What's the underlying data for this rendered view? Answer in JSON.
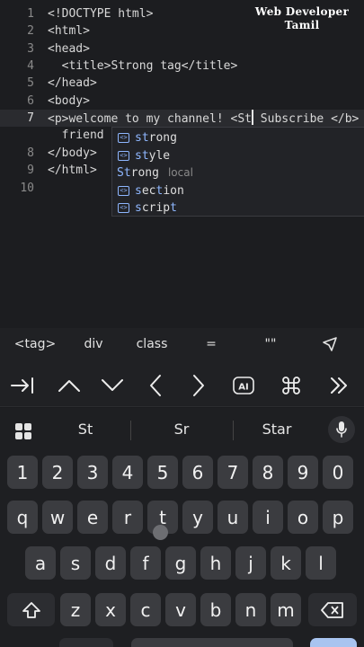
{
  "watermark": [
    "Web Developer",
    "Tamil"
  ],
  "editor": {
    "lines": [
      {
        "n": "1",
        "text": "<!DOCTYPE html>"
      },
      {
        "n": "2",
        "text": "<html>"
      },
      {
        "n": "3",
        "text": "<head>"
      },
      {
        "n": "4",
        "text": "  <title>Strong tag</title>"
      },
      {
        "n": "5",
        "text": "</head>"
      },
      {
        "n": "6",
        "text": "<body>"
      },
      {
        "n": "7",
        "before": "<p>welcome to my channel! <St",
        "after": " Subscribe </b>"
      },
      {
        "n": "",
        "text": "  friend"
      },
      {
        "n": "8",
        "text": "</body>"
      },
      {
        "n": "9",
        "text": "</html>"
      },
      {
        "n": "10",
        "text": ""
      }
    ]
  },
  "autocomplete": [
    {
      "match": "st",
      "rest": "rong",
      "icon": true
    },
    {
      "match": "st",
      "rest": "yle",
      "icon": true
    },
    {
      "match": "St",
      "rest": "rong",
      "icon": false,
      "hint": "local"
    },
    {
      "match": "s",
      "rest": "ec",
      "match2": "t",
      "rest2": "ion",
      "icon": true
    },
    {
      "match": "s",
      "rest": "crip",
      "match2": "t",
      "rest2": "",
      "icon": true
    }
  ],
  "symbols": [
    "<tag>",
    "div",
    "class",
    "=",
    "\"\""
  ],
  "suggestions": [
    "St",
    "Sr",
    "Star"
  ],
  "keys": {
    "numbers": [
      "1",
      "2",
      "3",
      "4",
      "5",
      "6",
      "7",
      "8",
      "9",
      "0"
    ],
    "row1": [
      "q",
      "w",
      "e",
      "r",
      "t",
      "y",
      "u",
      "i",
      "o",
      "p"
    ],
    "row2": [
      "a",
      "s",
      "d",
      "f",
      "g",
      "h",
      "j",
      "k",
      "l"
    ],
    "row3": [
      "z",
      "x",
      "c",
      "v",
      "b",
      "n",
      "m"
    ]
  },
  "colors": {
    "accent": "#a8c4f0",
    "match": "#8fb7ff",
    "background": "#1c1d20"
  }
}
